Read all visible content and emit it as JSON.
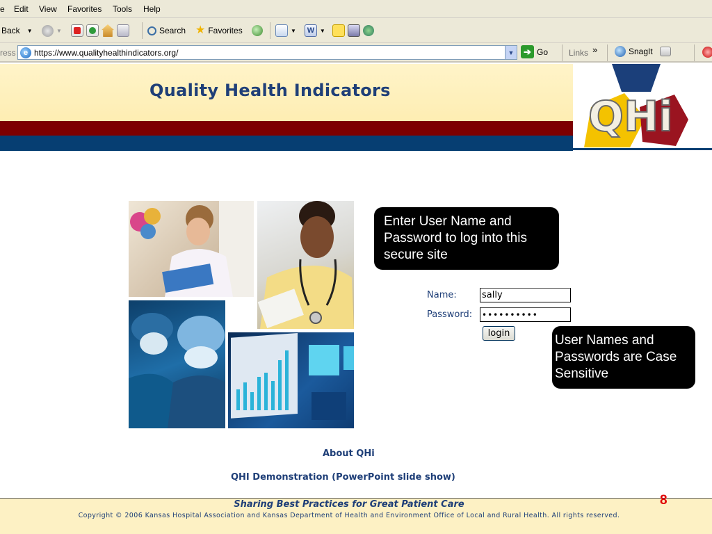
{
  "browser": {
    "menu": [
      "e",
      "Edit",
      "View",
      "Favorites",
      "Tools",
      "Help"
    ],
    "toolbar": {
      "back": "Back",
      "search": "Search",
      "favorites": "Favorites"
    },
    "address": {
      "label": "ress",
      "url": "https://www.qualityhealthindicators.org/",
      "go": "Go"
    },
    "links": "Links",
    "snagit": "SnagIt"
  },
  "site": {
    "title": "Quality Health Indicators",
    "logo_text": "QHi"
  },
  "callouts": {
    "login_hint": "Enter User Name and Password to log into this secure site",
    "case_note": "User Names and Passwords are Case Sensitive"
  },
  "form": {
    "name_label": "Name:",
    "name_value": "sally",
    "password_label": "Password:",
    "password_value": "••••••••••",
    "login_label": "login"
  },
  "links": {
    "about": "About QHi",
    "demo": "QHI Demonstration (PowerPoint slide show)"
  },
  "footer": {
    "tagline": "Sharing Best Practices for Great Patient Care",
    "copyright": "Copyright © 2006 Kansas Hospital Association and Kansas Department of Health and Environment Office of Local and Rural Health. All rights reserved.",
    "slide_number": "8"
  },
  "colors": {
    "brand_navy": "#1f3f78",
    "stripe_red": "#7d0000",
    "stripe_blue": "#063e72",
    "banner_yellow": "#fdeaa7"
  }
}
